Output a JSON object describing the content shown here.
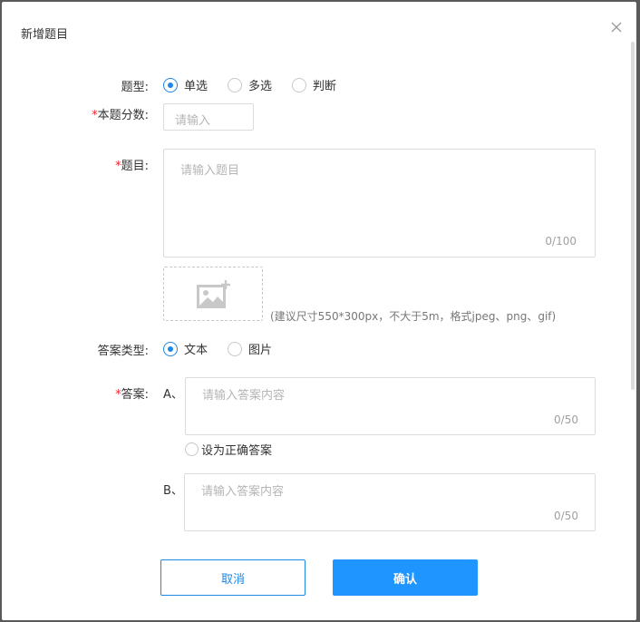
{
  "dialog": {
    "title": "新增题目"
  },
  "form": {
    "type_label": "题型:",
    "type_options": [
      "单选",
      "多选",
      "判断"
    ],
    "type_selected": "单选",
    "score_label": "本题分数:",
    "score_placeholder": "请输入",
    "question_label": "题目:",
    "question_placeholder": "请输入题目",
    "question_counter": "0/100",
    "upload_hint": "(建议尺寸550*300px，不大于5m，格式jpeg、png、gif)",
    "answer_type_label": "答案类型:",
    "answer_type_options": [
      "文本",
      "图片"
    ],
    "answer_type_selected": "文本",
    "answer_label": "答案:",
    "answers": [
      {
        "letter": "A、",
        "placeholder": "请输入答案内容",
        "counter": "0/50",
        "correct_label": "设为正确答案"
      },
      {
        "letter": "B、",
        "placeholder": "请输入答案内容",
        "counter": "0/50"
      }
    ],
    "required_mark": "*"
  },
  "footer": {
    "cancel_label": "取消",
    "confirm_label": "确认"
  },
  "colors": {
    "accent": "#1e88e5",
    "primary_button": "#1e95ff",
    "required": "#f5222d"
  }
}
